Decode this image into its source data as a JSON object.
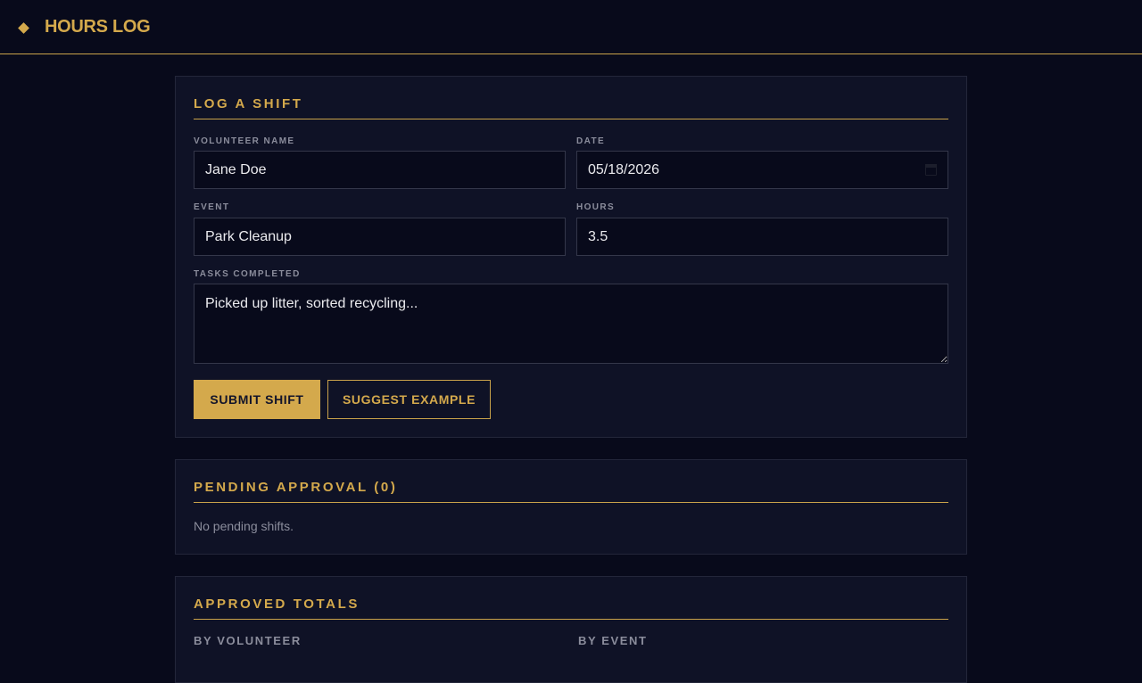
{
  "header": {
    "title": "HOURS LOG",
    "icon": "diamond-icon"
  },
  "log_shift": {
    "title": "LOG A SHIFT",
    "volunteer_label": "VOLUNTEER NAME",
    "volunteer_value": "Jane Doe",
    "date_label": "DATE",
    "date_value": "05/18/2026",
    "event_label": "EVENT",
    "event_value": "Park Cleanup",
    "hours_label": "HOURS",
    "hours_value": "3.5",
    "tasks_label": "TASKS COMPLETED",
    "tasks_value": "Picked up litter, sorted recycling...",
    "submit_label": "SUBMIT SHIFT",
    "suggest_label": "SUGGEST EXAMPLE"
  },
  "pending": {
    "title": "PENDING APPROVAL (0)",
    "empty_text": "No pending shifts."
  },
  "totals": {
    "title": "APPROVED TOTALS",
    "by_volunteer": "BY VOLUNTEER",
    "by_event": "BY EVENT"
  },
  "colors": {
    "accent": "#d4a94c",
    "background": "#080a1b",
    "panel": "#0f1226"
  }
}
